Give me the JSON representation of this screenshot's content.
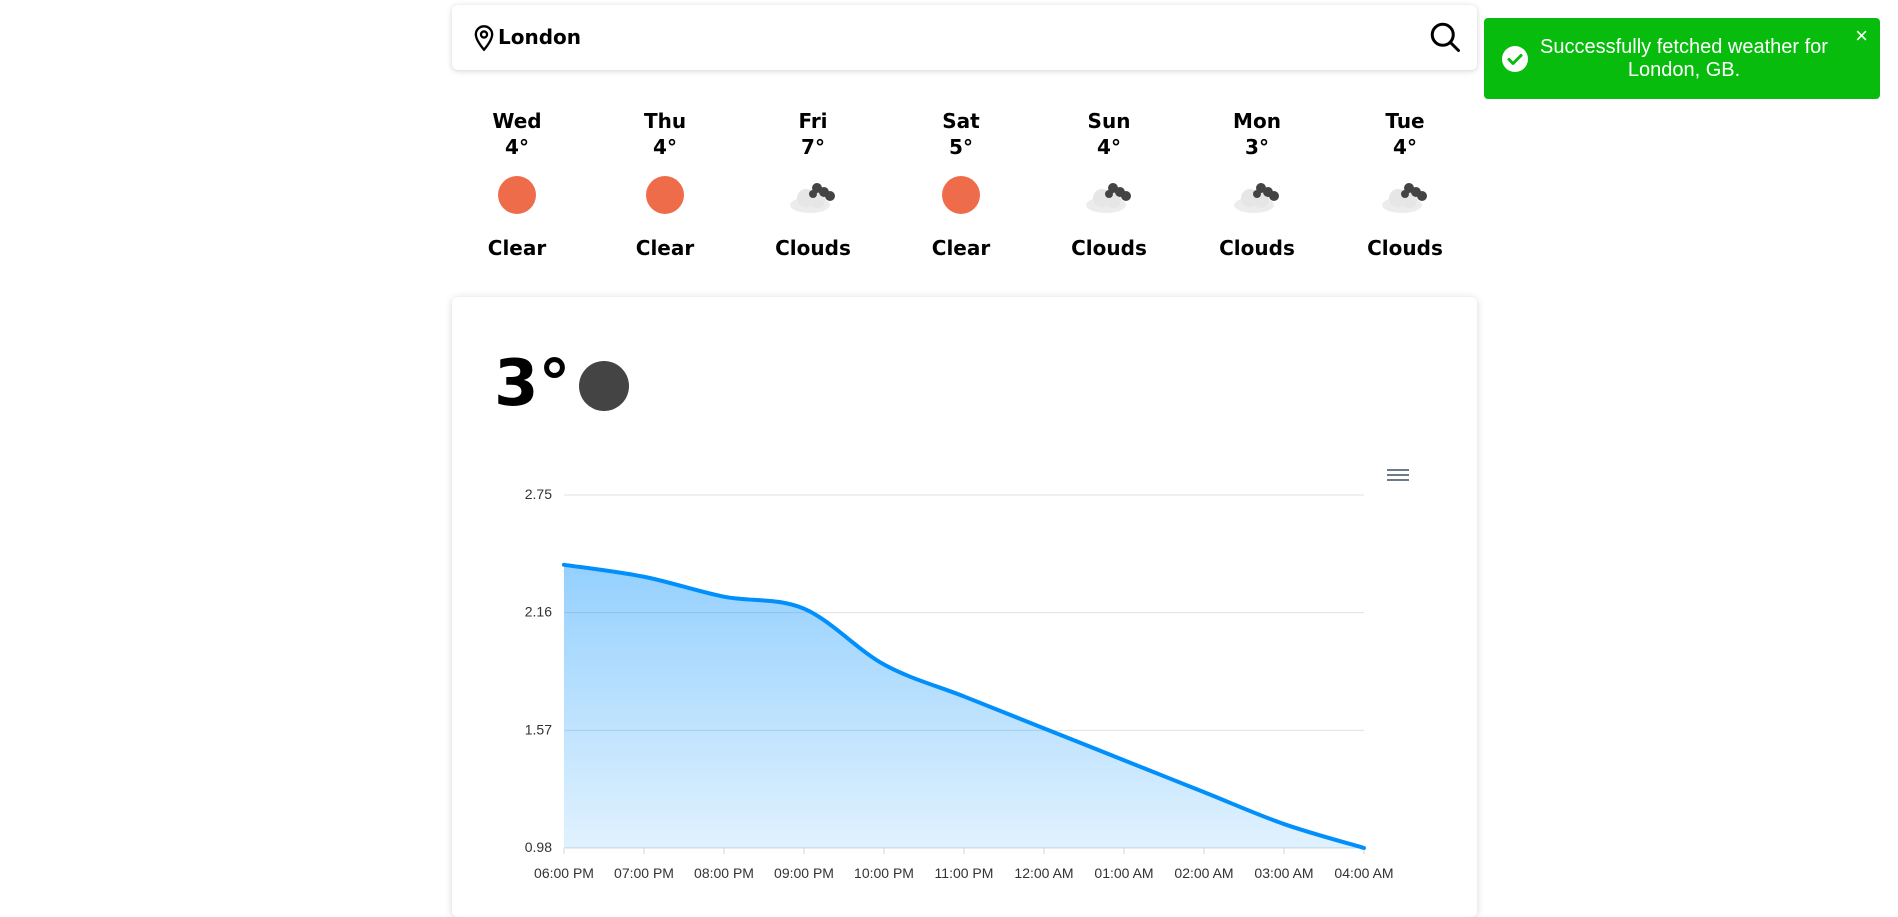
{
  "search": {
    "value": "London"
  },
  "forecast": [
    {
      "day": "Wed",
      "temp": "4°",
      "icon": "sun-icon",
      "desc": "Clear"
    },
    {
      "day": "Thu",
      "temp": "4°",
      "icon": "sun-icon",
      "desc": "Clear"
    },
    {
      "day": "Fri",
      "temp": "7°",
      "icon": "clouds-icon",
      "desc": "Clouds"
    },
    {
      "day": "Sat",
      "temp": "5°",
      "icon": "sun-icon",
      "desc": "Clear"
    },
    {
      "day": "Sun",
      "temp": "4°",
      "icon": "clouds-icon",
      "desc": "Clouds"
    },
    {
      "day": "Mon",
      "temp": "3°",
      "icon": "clouds-icon",
      "desc": "Clouds"
    },
    {
      "day": "Tue",
      "temp": "4°",
      "icon": "clouds-icon",
      "desc": "Clouds"
    }
  ],
  "current": {
    "temp": "3°",
    "icon": "moon-icon"
  },
  "toast": {
    "message": "Successfully fetched weather for London, GB.",
    "close": "×"
  },
  "colors": {
    "sun": "#ef6c4a",
    "toast": "#07bc0c",
    "line": "#008ffb",
    "moon": "#444444"
  },
  "chart_data": {
    "type": "area",
    "x": [
      "06:00 PM",
      "07:00 PM",
      "08:00 PM",
      "09:00 PM",
      "10:00 PM",
      "11:00 PM",
      "12:00 AM",
      "01:00 AM",
      "02:00 AM",
      "03:00 AM",
      "04:00 AM"
    ],
    "values": [
      2.4,
      2.34,
      2.24,
      2.18,
      1.9,
      1.74,
      1.58,
      1.42,
      1.26,
      1.1,
      0.98
    ],
    "yticks": [
      "2.75",
      "2.16",
      "1.57",
      "0.98"
    ],
    "ylim": [
      0.98,
      2.75
    ],
    "grid": true,
    "title": "",
    "xlabel": "",
    "ylabel": ""
  }
}
